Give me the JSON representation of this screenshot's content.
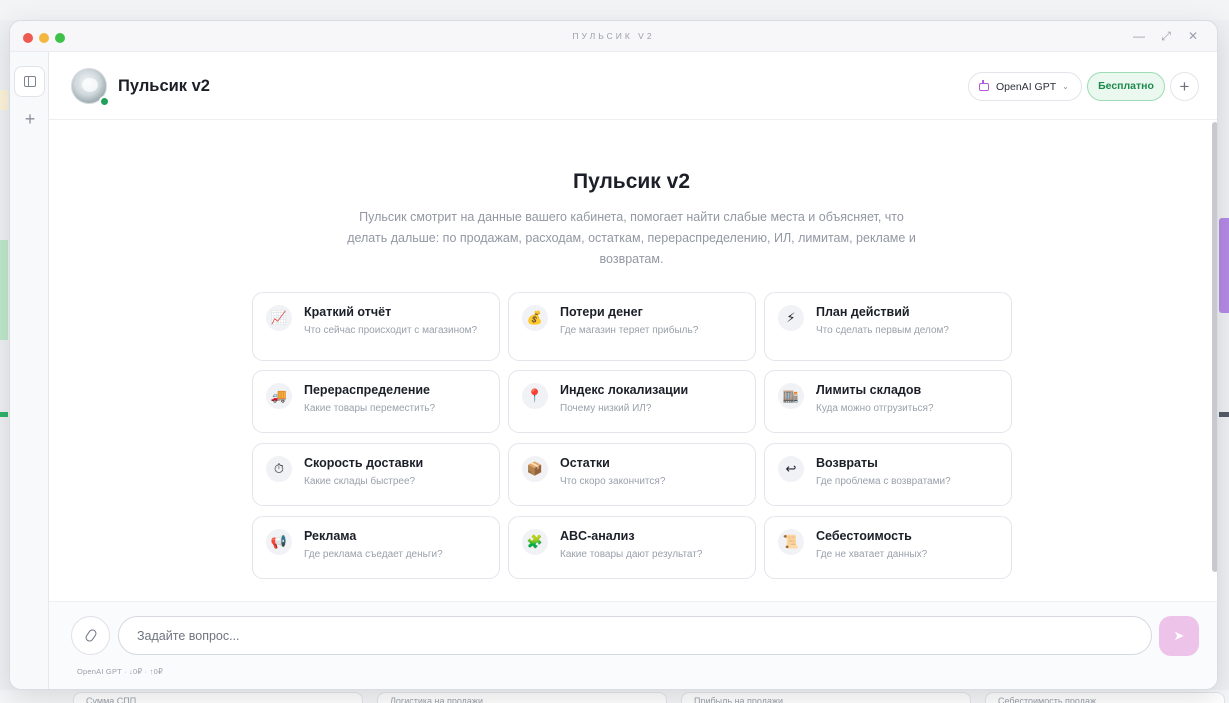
{
  "window": {
    "title": "ПУЛЬСИК V2"
  },
  "header": {
    "title": "Пульсик v2",
    "model_label": "OpenAI GPT",
    "plan_badge": "Бесплатно"
  },
  "intro": {
    "title": "Пульсик v2",
    "description": "Пульсик смотрит на данные вашего кабинета, помогает найти слабые места и объясняет, что делать дальше: по продажам, расходам, остаткам, перераспределению, ИЛ, лимитам, рекламе и возвратам."
  },
  "cards": [
    {
      "title": "Краткий отчёт",
      "subtitle": "Что сейчас происходит с магазином?",
      "icon": "chart-icon",
      "glyph": "📈"
    },
    {
      "title": "Потери денег",
      "subtitle": "Где магазин теряет прибыль?",
      "icon": "money-bag-icon",
      "glyph": "💰"
    },
    {
      "title": "План действий",
      "subtitle": "Что сделать первым делом?",
      "icon": "lightning-icon",
      "glyph": "⚡"
    },
    {
      "title": "Перераспределение",
      "subtitle": "Какие товары переместить?",
      "icon": "truck-icon",
      "glyph": "🚚"
    },
    {
      "title": "Индекс локализации",
      "subtitle": "Почему низкий ИЛ?",
      "icon": "pin-icon",
      "glyph": "📍"
    },
    {
      "title": "Лимиты складов",
      "subtitle": "Куда можно отгрузиться?",
      "icon": "warehouse-icon",
      "glyph": "🏬"
    },
    {
      "title": "Скорость доставки",
      "subtitle": "Какие склады быстрее?",
      "icon": "stopwatch-icon",
      "glyph": "⏱"
    },
    {
      "title": "Остатки",
      "subtitle": "Что скоро закончится?",
      "icon": "box-icon",
      "glyph": "📦"
    },
    {
      "title": "Возвраты",
      "subtitle": "Где проблема с возвратами?",
      "icon": "return-icon",
      "glyph": "↩"
    },
    {
      "title": "Реклама",
      "subtitle": "Где реклама съедает деньги?",
      "icon": "megaphone-icon",
      "glyph": "📢"
    },
    {
      "title": "ABC-анализ",
      "subtitle": "Какие товары дают результат?",
      "icon": "puzzle-icon",
      "glyph": "🧩"
    },
    {
      "title": "Себестоимость",
      "subtitle": "Где не хватает данных?",
      "icon": "receipt-icon",
      "glyph": "📜"
    }
  ],
  "composer": {
    "placeholder": "Задайте вопрос...",
    "meta": "OpenAI GPT · ↓0₽ · ↑0₽"
  },
  "background": {
    "tiles": [
      "Сумма СПП",
      "Логистика на продажи",
      "Прибыль на продажи",
      "Себестоимость продаж"
    ]
  },
  "colors": {
    "accent_green": "#1fa05a",
    "send_button": "#edc3e9",
    "bot_icon": "#b25dd1"
  }
}
